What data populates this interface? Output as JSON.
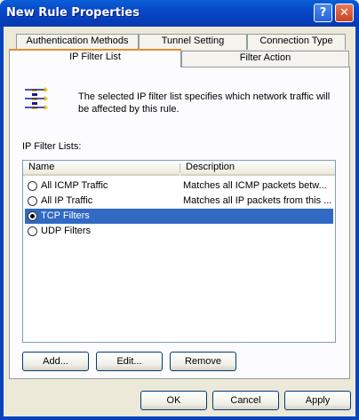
{
  "window": {
    "title": "New Rule Properties",
    "help_glyph": "?",
    "close_glyph": "✕"
  },
  "tabs": {
    "row1": [
      "Authentication Methods",
      "Tunnel Setting",
      "Connection Type"
    ],
    "row2": [
      "IP Filter List",
      "Filter Action"
    ],
    "active": "IP Filter List"
  },
  "info": {
    "icon": "ip-filter-list-icon",
    "text": "The selected IP filter list specifies which network traffic will be affected by this rule."
  },
  "list": {
    "label": "IP Filter Lists:",
    "columns": [
      "Name",
      "Description"
    ],
    "rows": [
      {
        "name": "All ICMP Traffic",
        "description": "Matches all ICMP packets betw...",
        "selected": false
      },
      {
        "name": "All IP Traffic",
        "description": "Matches all IP packets from this ...",
        "selected": false
      },
      {
        "name": "TCP Filters",
        "description": "",
        "selected": true
      },
      {
        "name": "UDP Filters",
        "description": "",
        "selected": false
      }
    ]
  },
  "actions": {
    "add": "Add...",
    "edit": "Edit...",
    "remove": "Remove"
  },
  "footer": {
    "ok": "OK",
    "cancel": "Cancel",
    "apply": "Apply"
  },
  "colors": {
    "titlebar": "#0A5FD7",
    "selection": "#316AC5",
    "active_tab_accent": "#E68B2C"
  }
}
